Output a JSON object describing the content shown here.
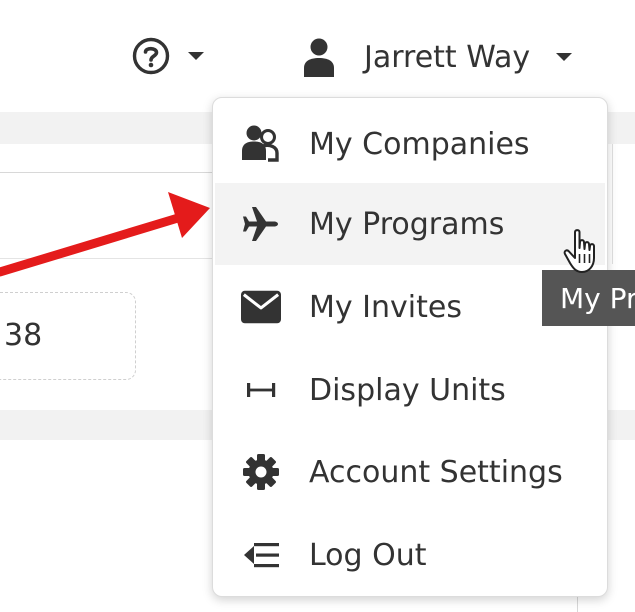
{
  "header": {
    "help_icon": "question-circle-icon",
    "user_icon": "user-icon",
    "user_name": "Jarrett Way"
  },
  "background": {
    "field_value": "38"
  },
  "menu": {
    "items": [
      {
        "label": "My Companies",
        "icon": "users-icon"
      },
      {
        "label": "My Programs",
        "icon": "plane-icon",
        "hovered": true
      },
      {
        "label": "My Invites",
        "icon": "envelope-icon"
      },
      {
        "label": "Display Units",
        "icon": "ruler-horizontal-icon"
      },
      {
        "label": "Account Settings",
        "icon": "gear-icon"
      },
      {
        "label": "Log Out",
        "icon": "logout-icon"
      }
    ]
  },
  "tooltip": {
    "text": "My Pr"
  },
  "colors": {
    "arrow": "#e41b1b",
    "tooltip_bg": "#555555",
    "hover_bg": "#f3f3f3",
    "text": "#333333"
  }
}
